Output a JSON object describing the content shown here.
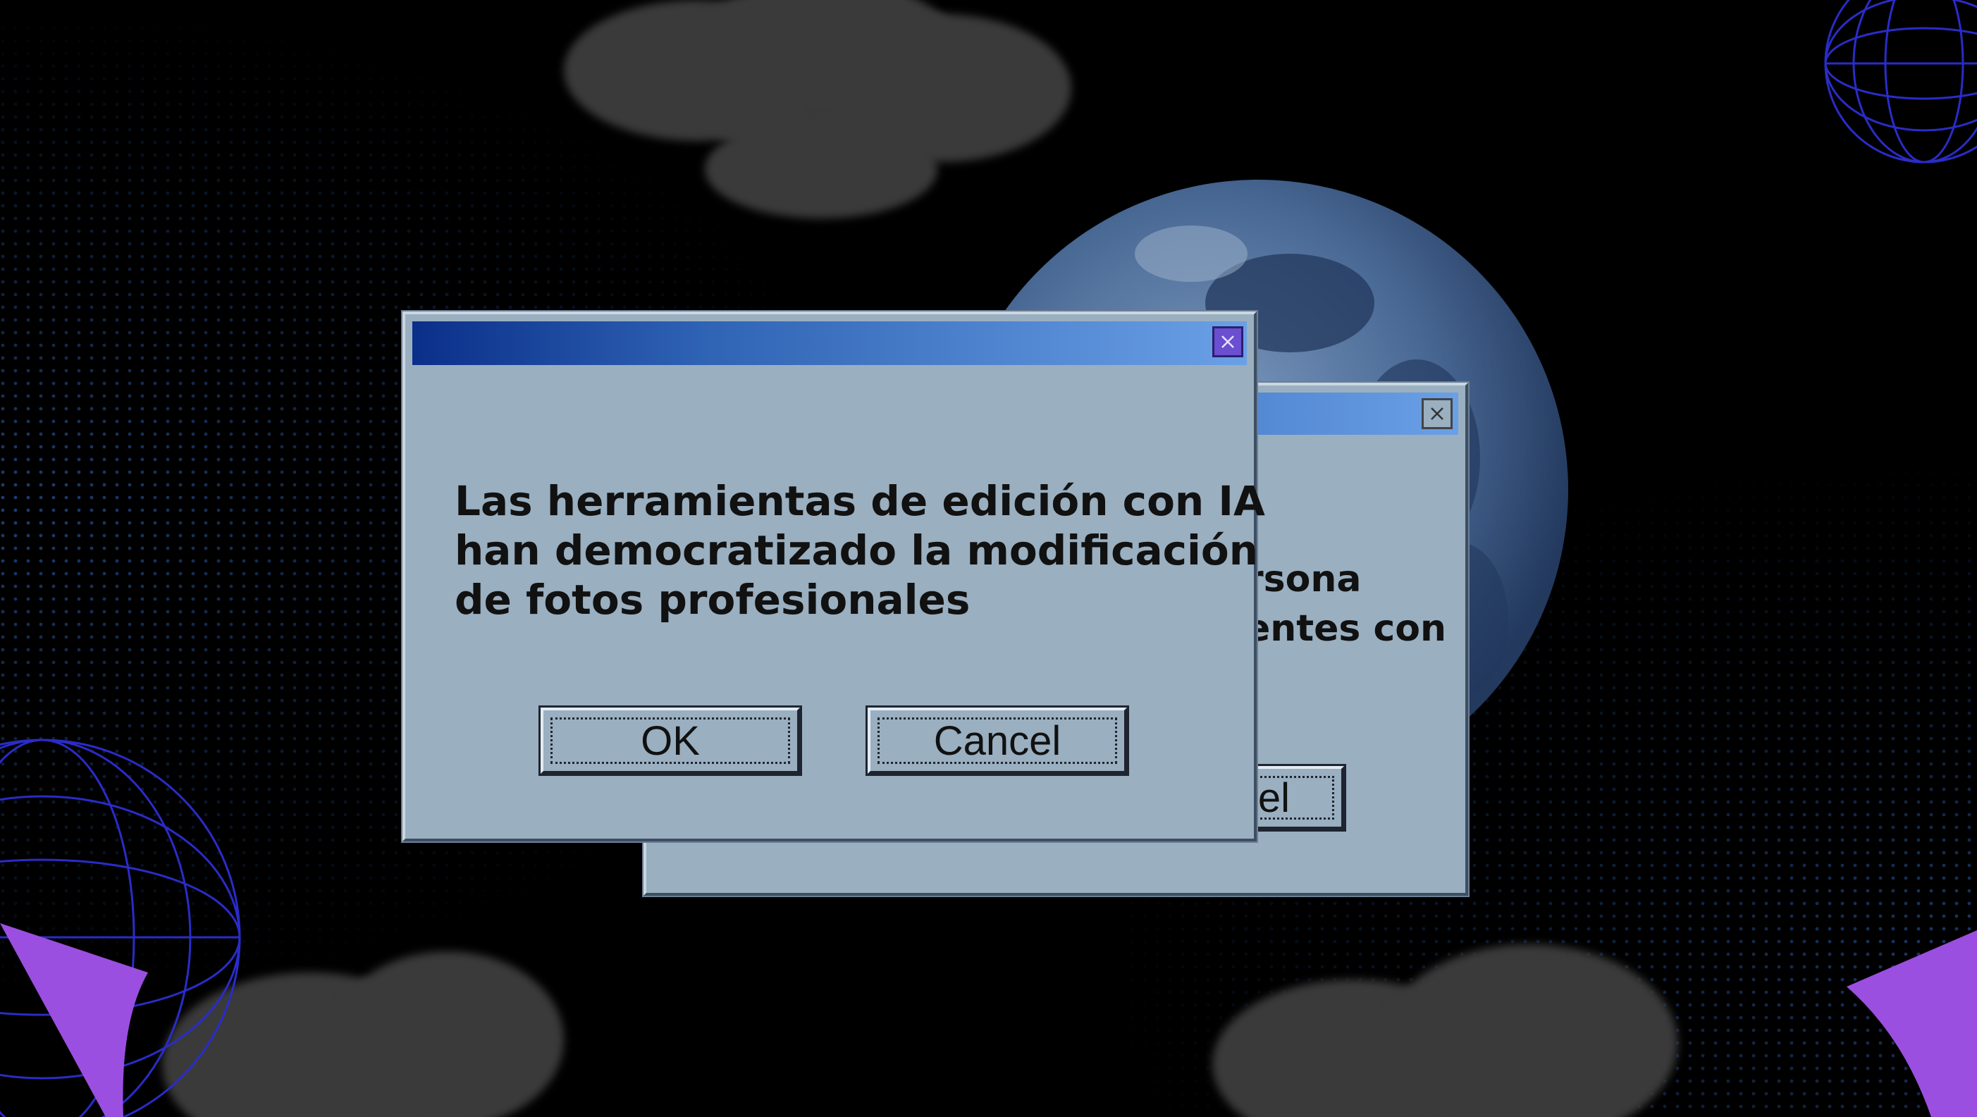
{
  "colors": {
    "background": "#000000",
    "dialog_face": "#9aafc0",
    "titlebar_start": "#0a2f8a",
    "titlebar_end": "#6aa0e6",
    "accent_purple": "#9b4fe0",
    "globe_lines": "#2a2cc8",
    "moon": "#4a6a96"
  },
  "front_dialog": {
    "message": [
      "Las herramientas de edición con IA",
      "han democratizado la modificación",
      "de fotos profesionales"
    ],
    "ok_label": "OK",
    "cancel_label": "Cancel",
    "close_icon": "close-icon"
  },
  "back_dialog": {
    "message_fragment": [
      "rsona",
      "entes con"
    ],
    "button_fragment": "el",
    "close_icon": "close-icon"
  }
}
